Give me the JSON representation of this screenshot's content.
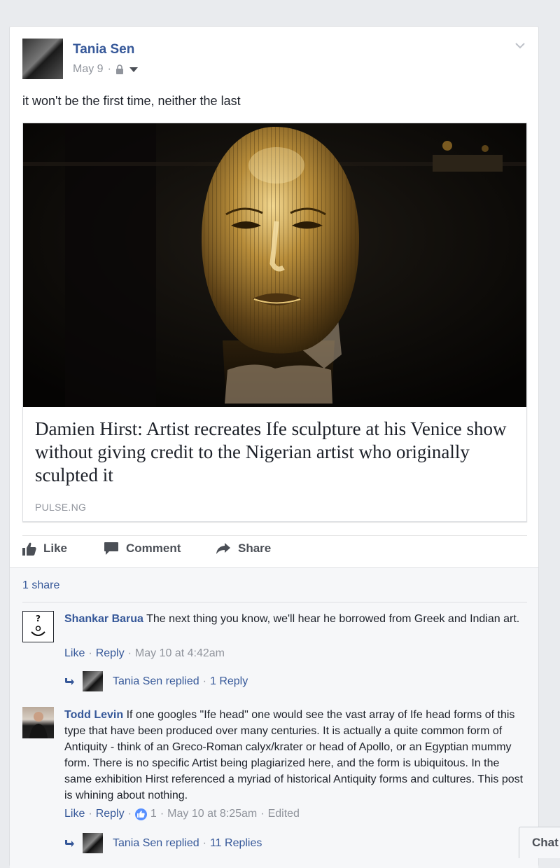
{
  "post": {
    "author": "Tania Sen",
    "date": "May 9",
    "separator": "·",
    "text": "it won't be the first time, neither the last",
    "link": {
      "title": "Damien Hirst: Artist recreates Ife sculpture at his Venice show without giving credit to the Nigerian artist who originally sculpted it",
      "domain": "PULSE.NG"
    }
  },
  "actions": {
    "like": "Like",
    "comment": "Comment",
    "share": "Share"
  },
  "shares": "1 share",
  "comments": [
    {
      "author": "Shankar Barua",
      "text": " The next thing you know, we'll hear he borrowed from Greek and Indian art.",
      "like": "Like",
      "reply": "Reply",
      "timestamp": "May 10 at 4:42am",
      "replies": {
        "who": "Tania Sen replied",
        "count": "1 Reply"
      }
    },
    {
      "author": "Todd Levin",
      "text": " If one googles \"Ife head\" one would see the vast array of Ife head forms of this type that have been produced over many centuries. It is actually a quite common form of Antiquity - think of an Greco-Roman calyx/krater or head of Apollo, or an Egyptian mummy form. There is no specific Artist being plagiarized here, and the form is ubiquitous. In the same exhibition Hirst referenced a myriad of historical Antiquity forms and cultures. This post is whining about nothing.",
      "like": "Like",
      "reply": "Reply",
      "reaction_count": "1",
      "timestamp": "May 10 at 8:25am",
      "edited": "Edited",
      "replies": {
        "who": "Tania Sen replied",
        "count": "11 Replies"
      }
    }
  ],
  "chat": {
    "label": "Chat"
  },
  "colors": {
    "link": "#365899",
    "muted": "#90949c",
    "background": "#e9ebee"
  }
}
